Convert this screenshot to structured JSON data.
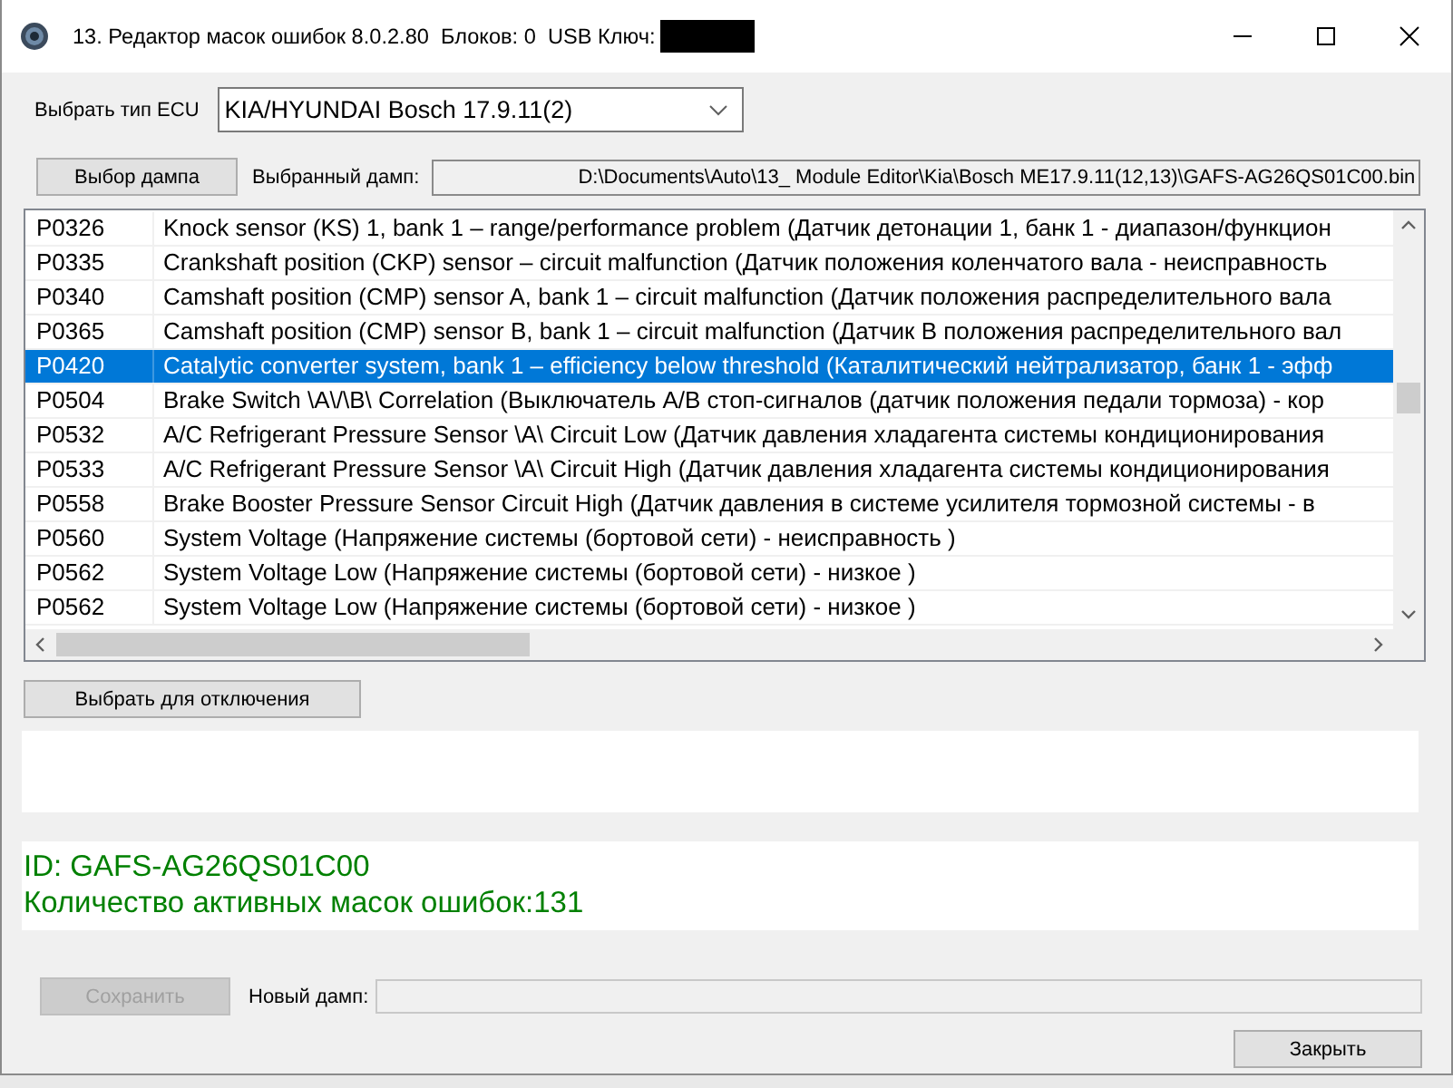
{
  "window": {
    "title": "13. Редактор масок ошибок 8.0.2.80  Блоков: 0  USB Ключ:"
  },
  "ecu_select": {
    "label": "Выбрать тип ECU",
    "value": "KIA/HYUNDAI Bosch 17.9.11(2)"
  },
  "dump": {
    "button": "Выбор дампа",
    "label": "Выбранный дамп:",
    "path": "D:\\Documents\\Auto\\13_ Module Editor\\Kia\\Bosch ME17.9.11(12,13)\\GAFS-AG26QS01C00.bin"
  },
  "error_list": {
    "rows": [
      {
        "code": "P0326",
        "description": "Knock sensor (KS) 1, bank 1 – range/performance problem (Датчик детонации 1, банк 1 - диапазон/функцион",
        "selected": false
      },
      {
        "code": "P0335",
        "description": "Crankshaft position (CKP) sensor – circuit malfunction (Датчик положения коленчатого вала - неисправность",
        "selected": false
      },
      {
        "code": "P0340",
        "description": "Camshaft position (CMP) sensor A, bank 1 – circuit malfunction (Датчик положения распределительного вала",
        "selected": false
      },
      {
        "code": "P0365",
        "description": "Camshaft position (CMP) sensor B, bank 1 – circuit malfunction (Датчик В положения распределительного вал",
        "selected": false
      },
      {
        "code": "P0420",
        "description": "Catalytic converter system, bank 1 – efficiency below threshold (Каталитический нейтрализатор, банк 1 - эфф",
        "selected": true
      },
      {
        "code": "P0504",
        "description": "Brake Switch \\A\\/\\B\\ Correlation (Выключатель А/В стоп-сигналов (датчик положения педали тормоза) - кор",
        "selected": false
      },
      {
        "code": "P0532",
        "description": "A/C Refrigerant Pressure Sensor \\A\\ Circuit Low (Датчик давления хладагента системы кондиционирования",
        "selected": false
      },
      {
        "code": "P0533",
        "description": "A/C Refrigerant Pressure Sensor \\A\\ Circuit High (Датчик давления хладагента системы кондиционирования",
        "selected": false
      },
      {
        "code": "P0558",
        "description": "Brake Booster Pressure Sensor Circuit High (Датчик давления в системе усилителя тормозной системы - в",
        "selected": false
      },
      {
        "code": "P0560",
        "description": "System Voltage (Напряжение системы (бортовой сети) - неисправность )",
        "selected": false
      },
      {
        "code": "P0562",
        "description": "System Voltage Low (Напряжение системы (бортовой сети) - низкое )",
        "selected": false
      },
      {
        "code": "P0562",
        "description": "System Voltage Low (Напряжение системы (бортовой сети) - низкое )",
        "selected": false
      }
    ]
  },
  "disable_button": {
    "label": "Выбрать для отключения"
  },
  "info_lines": [
    "ID: GAFS-AG26QS01C00",
    "Количество активных масок ошибок:131"
  ],
  "save": {
    "button": "Сохранить",
    "disabled": true,
    "label": "Новый дамп:"
  },
  "close_button": {
    "label": "Закрыть"
  }
}
